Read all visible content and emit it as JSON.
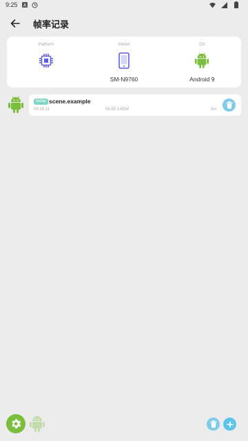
{
  "status_bar": {
    "time": "9:25"
  },
  "header": {
    "title": "帧率记录"
  },
  "device": {
    "platform_label": "Platform",
    "model_label": "Model",
    "model_value": "SM-N9760",
    "os_label": "OS",
    "os_value": "Android 9"
  },
  "records": [
    {
      "badge": "today",
      "name": "scene.example",
      "time": "09:25:11",
      "stats": "56.99  3.65W",
      "duration": "3m"
    }
  ],
  "colors": {
    "android_green": "#7bbd3c",
    "accent_blue": "#5ec3ea",
    "light_blue": "#7fcce8",
    "badge_teal": "#7fd6c6",
    "icon_purple": "#5a5fe0"
  }
}
